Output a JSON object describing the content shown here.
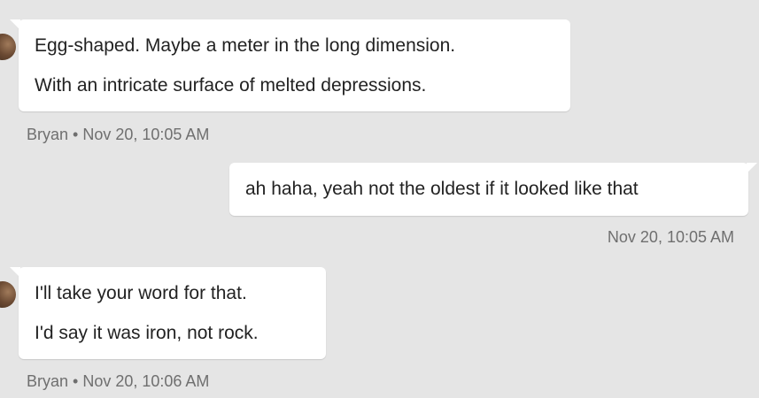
{
  "conversation": {
    "messages": [
      {
        "direction": "incoming",
        "lines": [
          "Egg-shaped. Maybe a meter in the long dimension.",
          "With an intricate surface of melted depressions."
        ],
        "meta": "Bryan • Nov 20, 10:05 AM",
        "avatar_icon": "user-avatar"
      },
      {
        "direction": "outgoing",
        "lines": [
          "ah haha, yeah not the oldest if it looked like that"
        ],
        "meta": "Nov 20, 10:05 AM"
      },
      {
        "direction": "incoming",
        "lines": [
          "I'll take your word for that.",
          "I'd say it was iron, not rock."
        ],
        "meta": "Bryan • Nov 20, 10:06 AM",
        "avatar_icon": "user-avatar"
      }
    ]
  },
  "colors": {
    "background": "#e5e5e5",
    "bubble": "#ffffff",
    "meta_text": "#6f6f6f",
    "message_text": "#222222"
  }
}
